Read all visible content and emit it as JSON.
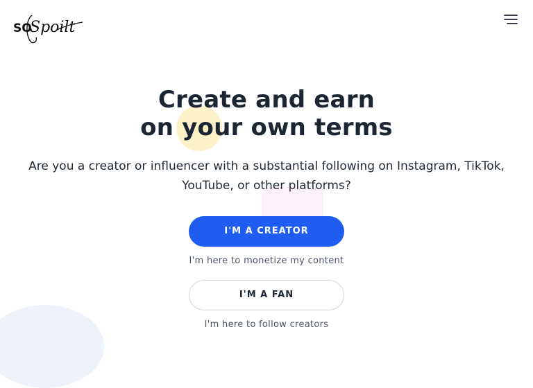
{
  "brand": {
    "logo_text_so": "SO",
    "logo_text_spoilt": "Spoilt",
    "accent_color": "#1f5cf2"
  },
  "header": {
    "menu_icon": "hamburger-menu-icon"
  },
  "hero": {
    "title_line1": "Create and earn",
    "title_line2": "on your own terms",
    "subtitle": "Are you a creator or influencer with a substantial following on Instagram, TikTok, YouTube, or other platforms?"
  },
  "actions": {
    "creator_label": "I'M A CREATOR",
    "creator_note": "I'm here to monetize my content",
    "fan_label": "I'M A FAN",
    "fan_note": "I'm here to follow creators"
  }
}
